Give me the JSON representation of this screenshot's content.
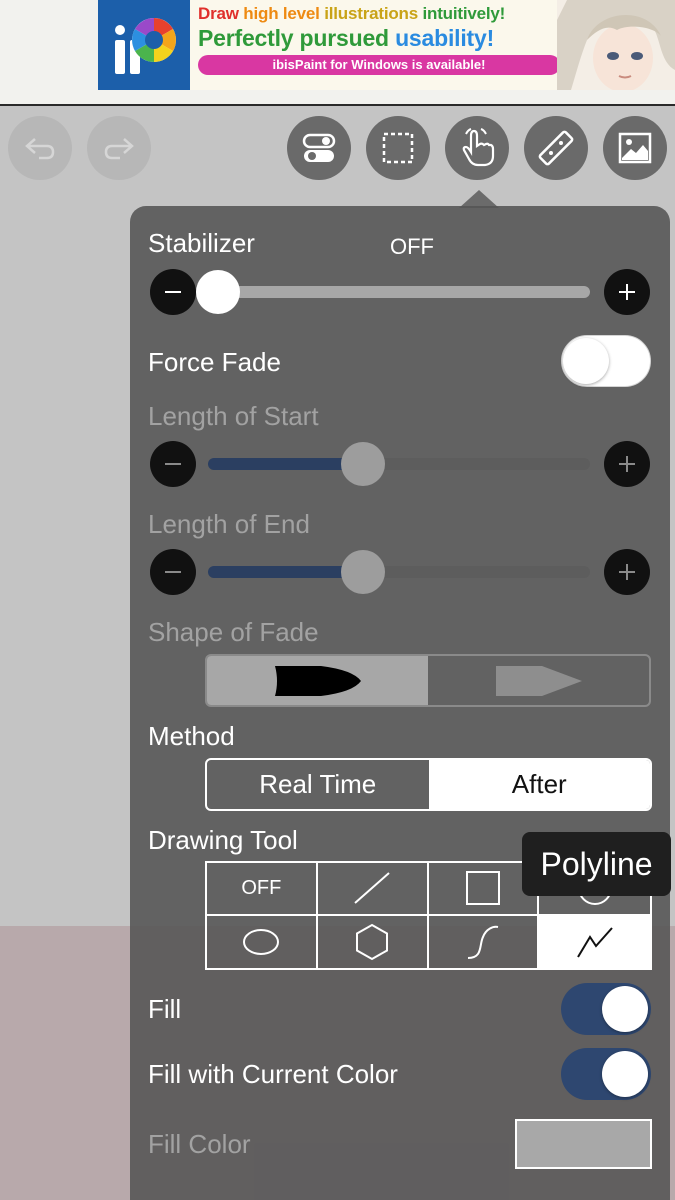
{
  "ad": {
    "line1_a": "Draw ",
    "line1_b": "high level ",
    "line1_c": "illustrations ",
    "line1_d": "intuitively!",
    "line2_a": "Perfectly pursued ",
    "line2_b": "usability!",
    "cta": "ibisPaint for Windows is available!",
    "colors": {
      "red": "#e0302c",
      "orange": "#ee8a12",
      "gold": "#c9a316",
      "green": "#2f9a3a",
      "blue": "#2a8be0",
      "pink": "#d937a2"
    }
  },
  "toolbar": {
    "buttons": [
      {
        "name": "undo-icon",
        "state": "disabled"
      },
      {
        "name": "redo-icon",
        "state": "disabled"
      },
      {
        "name": "toggle-settings-icon",
        "state": "enabled"
      },
      {
        "name": "selection-icon",
        "state": "enabled"
      },
      {
        "name": "hand-touch-icon",
        "state": "active"
      },
      {
        "name": "ruler-icon",
        "state": "enabled"
      },
      {
        "name": "image-icon",
        "state": "enabled"
      }
    ]
  },
  "panel": {
    "stabilizer": {
      "label": "Stabilizer",
      "value": "OFF",
      "level": 0.0
    },
    "force_fade": {
      "label": "Force Fade",
      "enabled": false
    },
    "length_of_start": {
      "label": "Length of Start",
      "level": 0.4,
      "enabled": false
    },
    "length_of_end": {
      "label": "Length of End",
      "level": 0.4,
      "enabled": false
    },
    "shape_of_fade": {
      "label": "Shape of Fade",
      "options": [
        "rounded-taper-icon",
        "straight-taper-icon"
      ],
      "selected_index": 0,
      "enabled": false
    },
    "method": {
      "label": "Method",
      "options": [
        "Real Time",
        "After"
      ],
      "selected": "After"
    },
    "drawing_tool": {
      "label": "Drawing Tool",
      "off_label": "OFF",
      "tools": [
        "off",
        "line-icon",
        "rectangle-icon",
        "circle-icon",
        "ellipse-icon",
        "hexagon-icon",
        "curve-icon",
        "polyline-icon"
      ],
      "selected": "polyline-icon",
      "tooltip": "Polyline"
    },
    "fill": {
      "label": "Fill",
      "enabled": true
    },
    "fill_with_current_color": {
      "label": "Fill with Current Color",
      "enabled": true
    },
    "fill_color": {
      "label": "Fill Color",
      "swatch": "#a8a8a8",
      "enabled": false
    }
  },
  "colors": {
    "toggle_on": "#2e4770",
    "slider_fill": "#2b3f61",
    "panel": "#545454"
  }
}
